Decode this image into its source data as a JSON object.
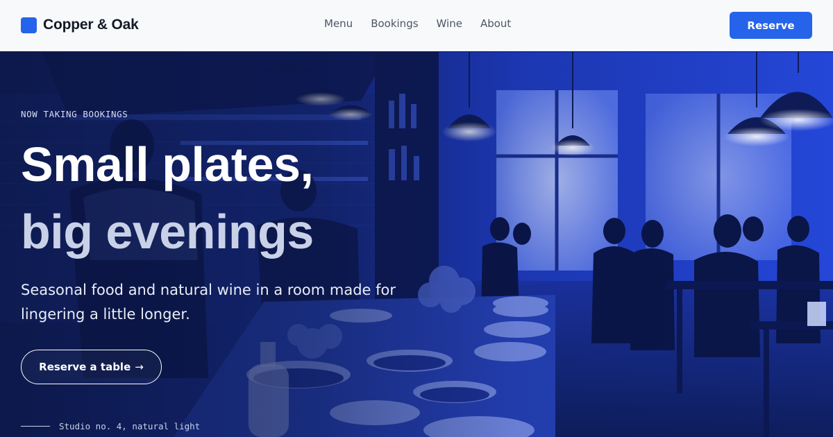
{
  "header": {
    "brand_name": "Copper & Oak",
    "nav": [
      {
        "label": "Menu"
      },
      {
        "label": "Bookings"
      },
      {
        "label": "Wine"
      },
      {
        "label": "About"
      }
    ],
    "reserve_label": "Reserve"
  },
  "hero": {
    "eyebrow": "NOW TAKING BOOKINGS",
    "headline_line1": "Small plates,",
    "headline_line2": "big evenings",
    "subcopy": "Seasonal food and natural wine in a room made for lingering a little longer.",
    "cta_label": "Reserve a table",
    "cta_arrow": "→",
    "caption": "Studio no. 4, natural light",
    "photo_description_icon": "restaurant-interior-photo"
  },
  "colors": {
    "accent": "#2563eb",
    "header_bg": "#f8f9fb",
    "photo_tint": "#1e3fd6",
    "headline_secondary": "#c9d1e8"
  }
}
